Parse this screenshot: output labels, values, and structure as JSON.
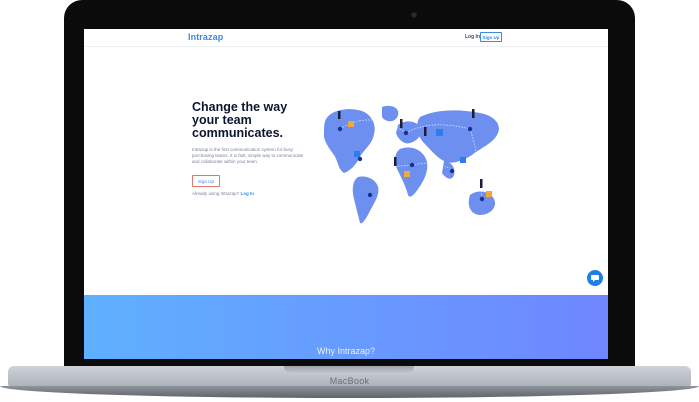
{
  "device": {
    "label": "MacBook"
  },
  "site": {
    "logo_text": "Intrazap",
    "nav": {
      "login_label": "Log In",
      "signup_label": "Sign Up"
    },
    "hero": {
      "title": "Change the way your team communicates.",
      "description": "Intrazap is the first communication system for busy purchasing teams. It is fast, simple way to communicate and collaborate within your team.",
      "signup_button": "Sign Up",
      "already_text": "Already using Intrazap?",
      "already_link": "Log In"
    },
    "section": {
      "title": "Why Intrazap?"
    }
  },
  "colors": {
    "accent": "#3b8ae6",
    "heading": "#0d1630",
    "map_fill": "#6d8ff0",
    "banner_start": "#5fb0ff",
    "banner_end": "#6f86ff"
  },
  "icons": {
    "chat": "chat-bubble-icon",
    "camera": "camera-icon"
  }
}
